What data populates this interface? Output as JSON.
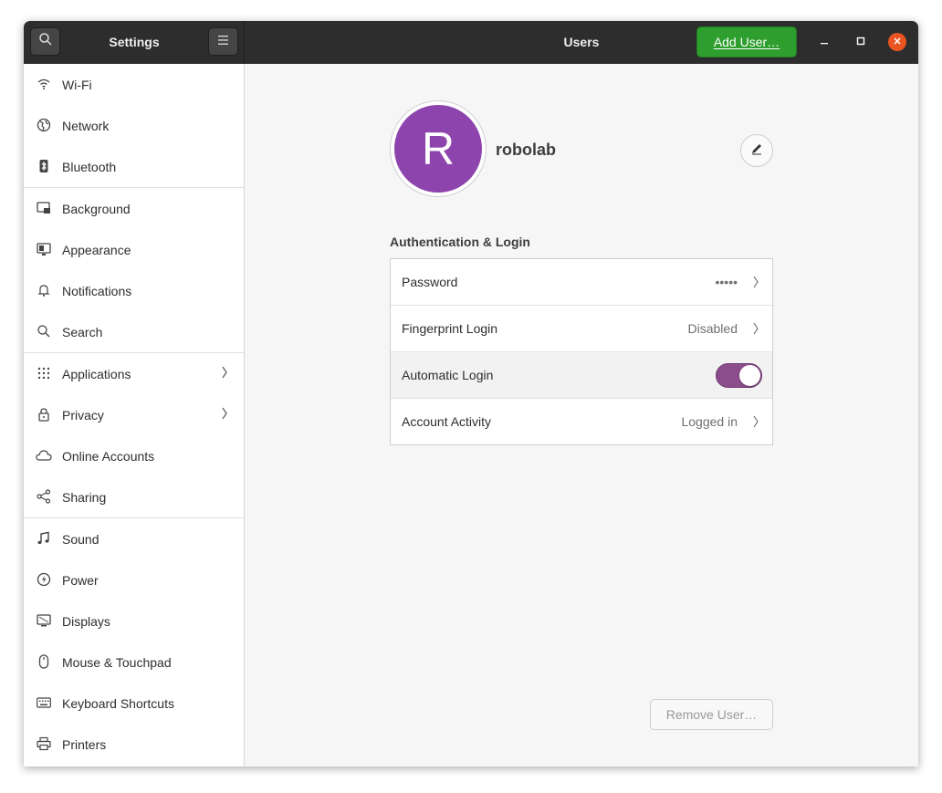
{
  "titlebar": {
    "sidebar_title": "Settings",
    "main_title": "Users",
    "add_user_label": "Add User…",
    "search_icon": "search-icon",
    "menu_icon": "hamburger-menu-icon"
  },
  "sidebar": {
    "items": [
      {
        "label": "Wi-Fi",
        "icon": "wifi-icon"
      },
      {
        "label": "Network",
        "icon": "network-globe-icon"
      },
      {
        "label": "Bluetooth",
        "icon": "bluetooth-icon"
      },
      {
        "label": "Background",
        "icon": "background-icon"
      },
      {
        "label": "Appearance",
        "icon": "appearance-icon"
      },
      {
        "label": "Notifications",
        "icon": "bell-icon"
      },
      {
        "label": "Search",
        "icon": "search-icon"
      },
      {
        "label": "Applications",
        "icon": "app-grid-icon",
        "has_chevron": true
      },
      {
        "label": "Privacy",
        "icon": "lock-icon",
        "has_chevron": true
      },
      {
        "label": "Online Accounts",
        "icon": "cloud-icon"
      },
      {
        "label": "Sharing",
        "icon": "share-icon"
      },
      {
        "label": "Sound",
        "icon": "music-note-icon"
      },
      {
        "label": "Power",
        "icon": "power-icon"
      },
      {
        "label": "Displays",
        "icon": "display-icon"
      },
      {
        "label": "Mouse & Touchpad",
        "icon": "mouse-icon"
      },
      {
        "label": "Keyboard Shortcuts",
        "icon": "keyboard-icon"
      },
      {
        "label": "Printers",
        "icon": "printer-icon"
      }
    ]
  },
  "user": {
    "avatar_letter": "R",
    "avatar_color": "#8e44ad",
    "name": "robolab"
  },
  "auth": {
    "section_title": "Authentication & Login",
    "rows": [
      {
        "label": "Password",
        "value": "•••••"
      },
      {
        "label": "Fingerprint Login",
        "value": "Disabled"
      },
      {
        "label": "Automatic Login",
        "toggle": true
      },
      {
        "label": "Account Activity",
        "value": "Logged in"
      }
    ]
  },
  "remove_user_label": "Remove User…",
  "colors": {
    "accent_green": "#2e9e2e",
    "toggle_on": "#8c4d8c",
    "close_orange": "#e95420"
  }
}
